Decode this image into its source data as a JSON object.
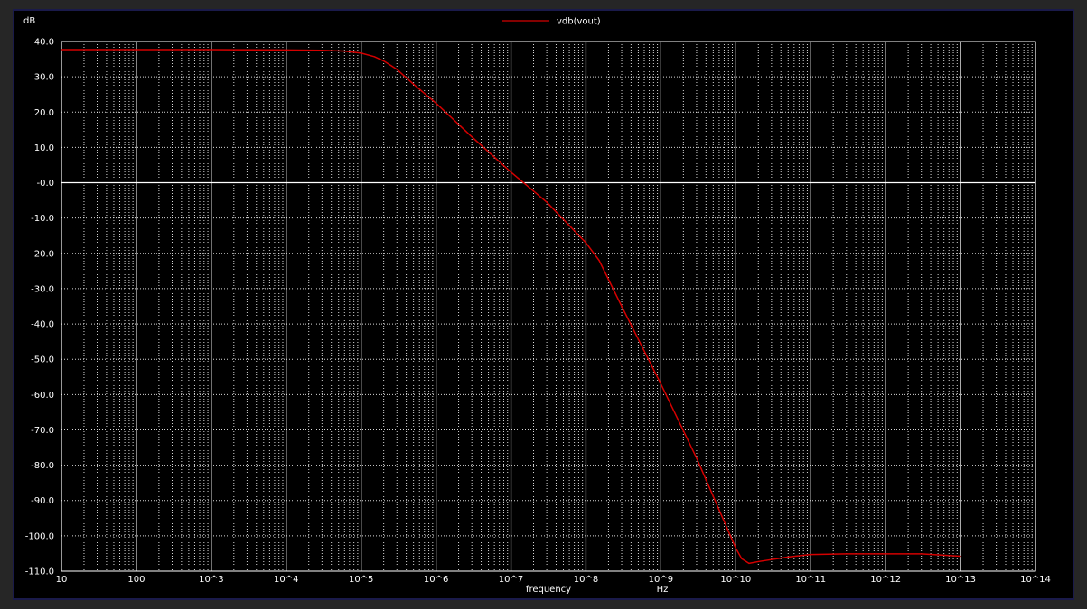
{
  "chart_data": {
    "type": "line",
    "title": "",
    "ylabel": "dB",
    "xlabel": "frequency",
    "xunit": "Hz",
    "xscale": "log",
    "xlim": [
      10,
      100000000000000
    ],
    "ylim": [
      -110,
      40
    ],
    "grid": true,
    "legend_position": "top-center",
    "background_color": "#000000",
    "grid_color": "#ffffff",
    "line_color": "#d40000",
    "x_tick_labels": [
      "10",
      "100",
      "10^3",
      "10^4",
      "10^5",
      "10^6",
      "10^7",
      "10^8",
      "10^9",
      "10^10",
      "10^11",
      "10^12",
      "10^13",
      "10^14"
    ],
    "x_ticks": [
      10,
      100,
      1000,
      10000,
      100000,
      1000000,
      10000000,
      100000000,
      1000000000,
      10000000000,
      100000000000,
      1000000000000,
      10000000000000,
      100000000000000
    ],
    "y_tick_labels": [
      "40.0",
      "30.0",
      "20.0",
      "10.0",
      "-0.0",
      "-10.0",
      "-20.0",
      "-30.0",
      "-40.0",
      "-50.0",
      "-60.0",
      "-70.0",
      "-80.0",
      "-90.0",
      "-100.0",
      "-110.0"
    ],
    "y_ticks": [
      40,
      30,
      20,
      10,
      0,
      -10,
      -20,
      -30,
      -40,
      -50,
      -60,
      -70,
      -80,
      -90,
      -100,
      -110
    ],
    "series": [
      {
        "name": "vdb(vout)",
        "x": [
          10,
          100,
          1000,
          10000,
          30000,
          60000,
          100000,
          150000,
          200000,
          300000,
          500000,
          1000000,
          3000000,
          10000000,
          30000000,
          100000000,
          150000000,
          300000000,
          1000000000,
          3000000000,
          10000000000,
          12000000000,
          15000000000,
          20000000000,
          50000000000,
          100000000000,
          300000000000,
          1000000000000,
          3000000000000,
          10000000000000
        ],
        "y": [
          37.7,
          37.7,
          37.7,
          37.6,
          37.5,
          37.3,
          36.7,
          35.7,
          34.5,
          32.1,
          27.9,
          22.5,
          13.0,
          3.0,
          -5.5,
          -17.0,
          -22.0,
          -35.0,
          -57.0,
          -78.0,
          -103.5,
          -106.5,
          -107.8,
          -107.3,
          -106.0,
          -105.3,
          -105.1,
          -105.1,
          -105.1,
          -105.8
        ]
      }
    ]
  }
}
